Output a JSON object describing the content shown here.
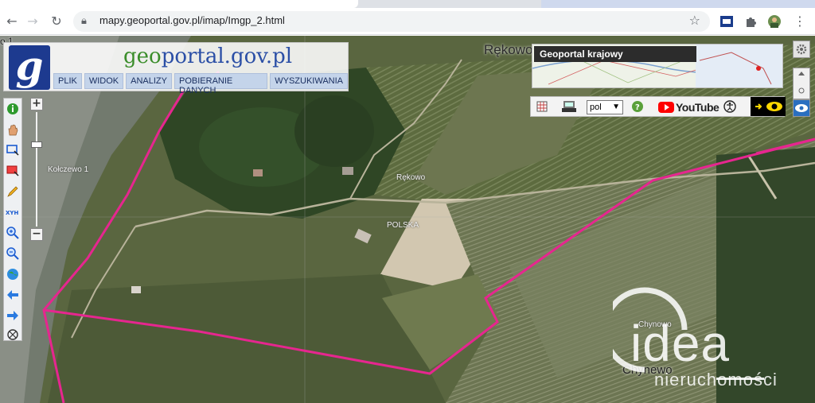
{
  "browser": {
    "url": "mapy.geoportal.gov.pl/imap/Imgp_2.html"
  },
  "header": {
    "logo_letter": "g",
    "title_prefix": "geo",
    "title_rest": "portal.gov.pl",
    "menu": [
      "PLIK",
      "WIDOK",
      "ANALIZY",
      "POBIERANIE DANYCH",
      "WYSZUKIWANIA"
    ]
  },
  "overview": {
    "title": "Geoportal krajowy"
  },
  "toolbar": {
    "language": "pol",
    "youtube_label": "YouTube"
  },
  "zoom": {
    "plus": "+",
    "minus": "−"
  },
  "map_labels": {
    "kolczewo": "Kołczewo 1",
    "rekowo_top": "Rękowo",
    "rekowo": "Rękowo",
    "polska": "POLSKA",
    "chynowo_small": "Chynowo",
    "chynowo": "Chynewo",
    "corner": "o 1"
  },
  "watermark": {
    "word": "idea",
    "sub": "nieruchomości"
  },
  "colors": {
    "boundary": "#e6268f",
    "logo_bg": "#1d3a8f",
    "menu_bg": "#c4d4ea"
  }
}
